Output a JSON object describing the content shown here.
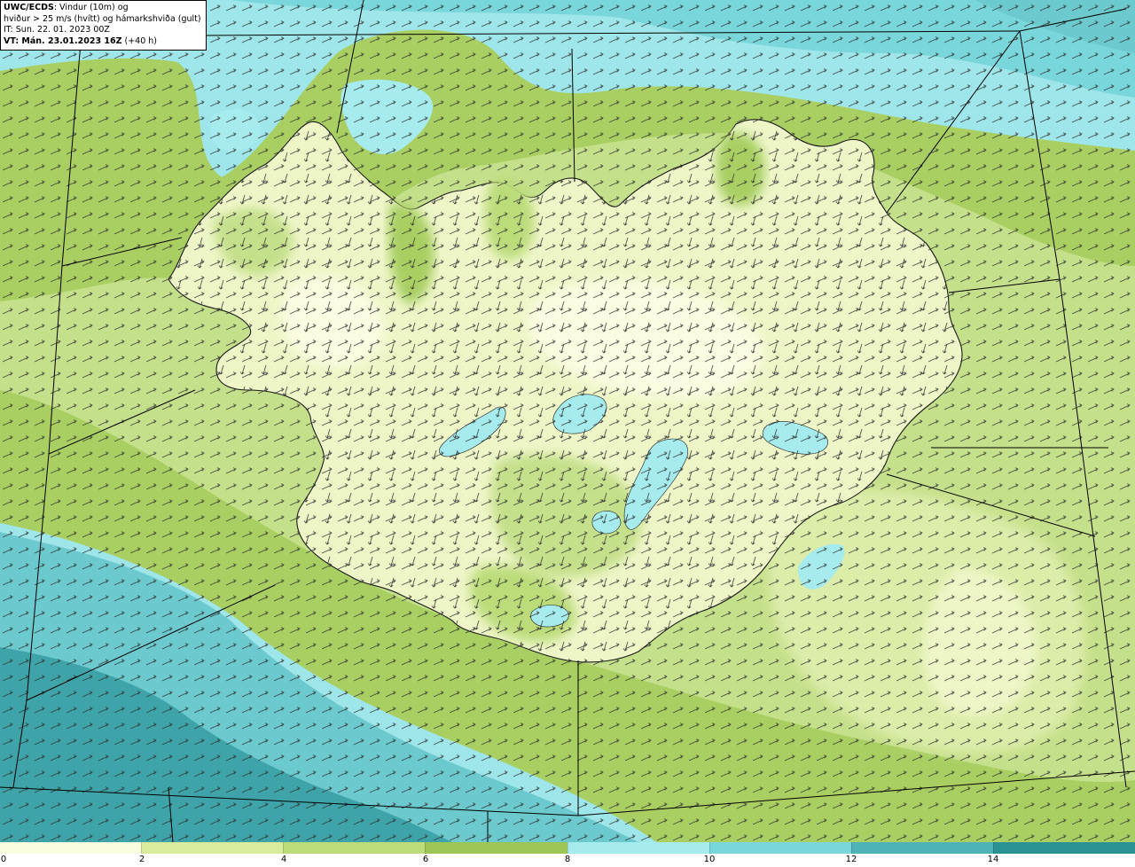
{
  "header": {
    "line1_bold": "UWC/ECDS",
    "line1_rest": ": Vindur (10m) og",
    "line2": "hviður > 25 m/s (hvítt) og hámarkshviða (gult)",
    "line3": "IT: Sun. 22. 01. 2023 00Z",
    "line4_bold": "VT: Mán. 23.01.2023 16Z",
    "line4_rest": " (+40 h)"
  },
  "colorbar": {
    "colors": [
      "#fbfde0",
      "#d9ec9e",
      "#bcdc7a",
      "#9ec657",
      "#a6ecef",
      "#79d6db",
      "#4db3b7",
      "#2a9293"
    ],
    "tick_labels": [
      "0",
      "2",
      "4",
      "6",
      "8",
      "10",
      "12",
      "14"
    ]
  },
  "palette": {
    "ocean_light": "#9fe6ea",
    "ocean_mid": "#6cc9ce",
    "ocean_dark": "#3fa4a9",
    "band_green": "#a9cf63",
    "band_green_light": "#c5e08b",
    "land_light": "#eef6c8",
    "land_pale": "#fbfde2",
    "lake": "#a6ecef",
    "coast": "#1a1a1a",
    "grid": "#000000",
    "arrow": "#2d2d2d"
  }
}
